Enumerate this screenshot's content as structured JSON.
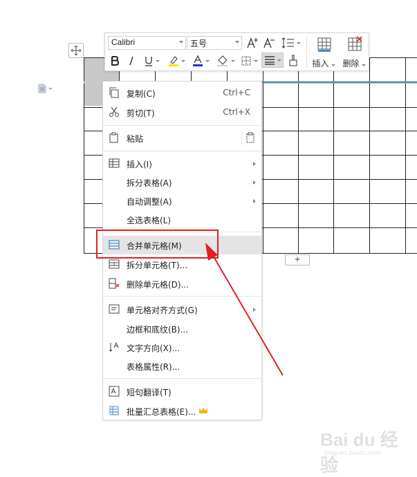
{
  "toolbar": {
    "font_name": "Calibri",
    "font_size": "五号",
    "insert_label": "插入",
    "delete_label": "删除"
  },
  "table": {
    "add_row_symbol": "+"
  },
  "context_menu": {
    "items": [
      {
        "label": "复制(C)",
        "shortcut": "Ctrl+C",
        "icon": "copy-icon"
      },
      {
        "label": "剪切(T)",
        "shortcut": "Ctrl+X",
        "icon": "cut-icon"
      },
      {
        "label": "粘贴",
        "icon": "paste-icon"
      },
      {
        "label": "插入(I)",
        "icon": "table-insert-icon"
      },
      {
        "label": "拆分表格(A)"
      },
      {
        "label": "自动调整(A)"
      },
      {
        "label": "全选表格(L)"
      },
      {
        "label": "合并单元格(M)",
        "icon": "merge-cells-icon"
      },
      {
        "label": "拆分单元格(T)...",
        "icon": "split-cells-icon"
      },
      {
        "label": "删除单元格(D)...",
        "icon": "delete-cells-icon"
      },
      {
        "label": "单元格对齐方式(G)",
        "icon": "cell-align-icon"
      },
      {
        "label": "边框和底纹(B)..."
      },
      {
        "label": "文字方向(X)...",
        "icon": "text-direction-icon"
      },
      {
        "label": "表格属性(R)..."
      },
      {
        "label": "短句翻译(T)",
        "icon": "translate-icon"
      },
      {
        "label": "批量汇总表格(E)...",
        "icon": "batch-summary-icon"
      }
    ]
  },
  "watermark": {
    "main": "Bai du 经验",
    "sub": "jingyan.baidu.com"
  },
  "colors": {
    "highlight_red": "#e02020",
    "menu_highlight": "#e4e4e4",
    "table_row_accent": "#5f8fa0",
    "selected_cell": "#c8c8c8"
  }
}
